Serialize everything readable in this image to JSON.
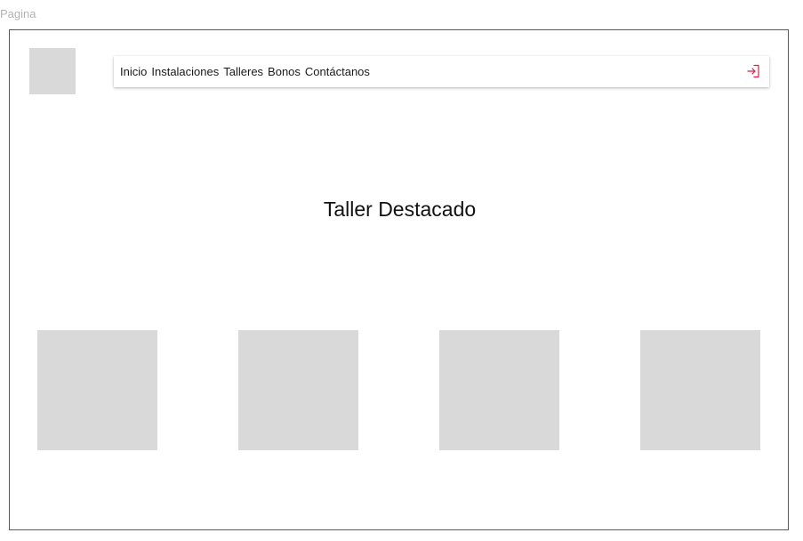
{
  "page": {
    "label": "Pagina"
  },
  "header": {
    "nav_items": [
      "Inicio",
      "Instalaciones",
      "Talleres",
      "Bonos",
      "Contáctanos"
    ],
    "login_icon": "login-icon",
    "login_icon_color": "#e11d48"
  },
  "main": {
    "title": "Taller Destacado",
    "card_count": 4
  }
}
